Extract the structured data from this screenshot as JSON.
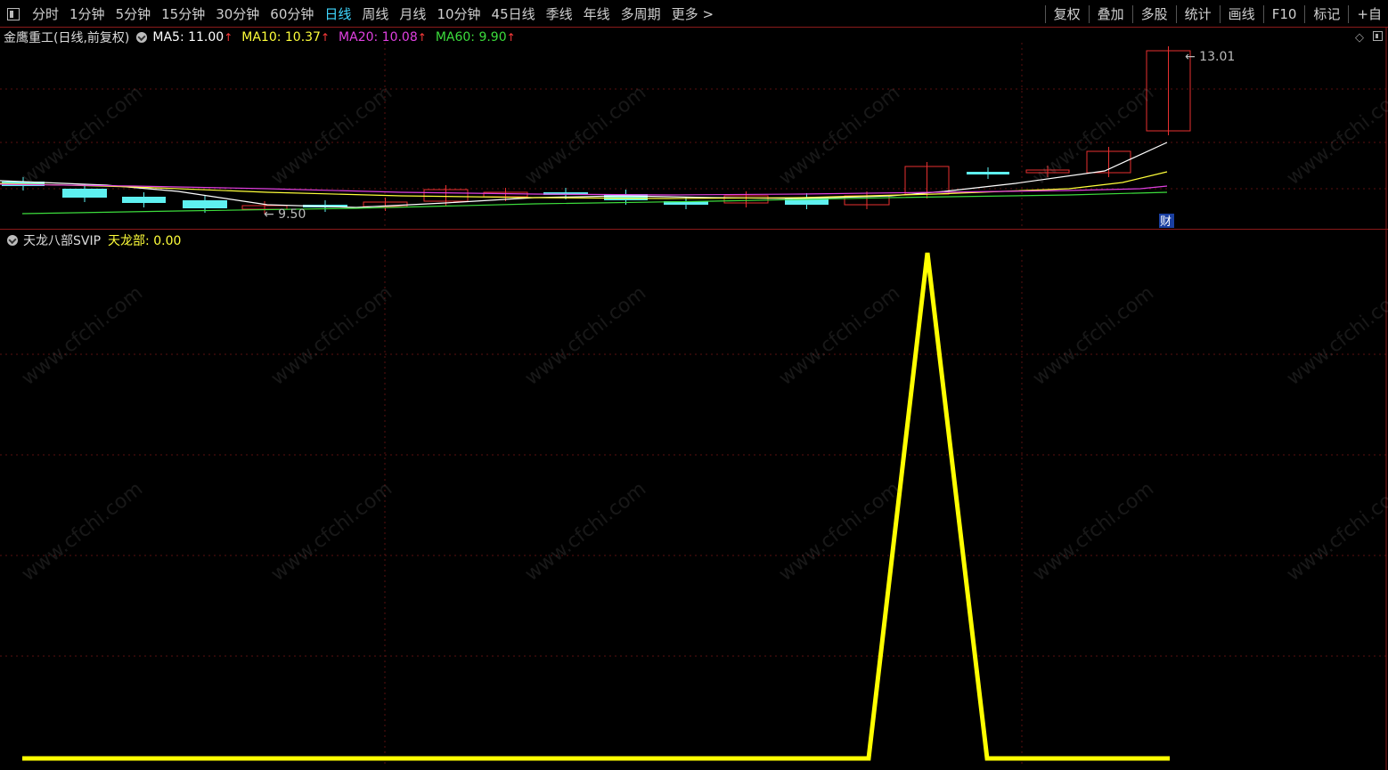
{
  "toolbar": {
    "periods": [
      "分时",
      "1分钟",
      "5分钟",
      "15分钟",
      "30分钟",
      "60分钟",
      "日线",
      "周线",
      "月线",
      "10分钟",
      "45日线",
      "季线",
      "年线",
      "多周期",
      "更多 >"
    ],
    "active_period": "日线",
    "right_tools": [
      "复权",
      "叠加",
      "多股",
      "统计",
      "画线",
      "F10",
      "标记",
      "+自"
    ]
  },
  "main_chart": {
    "stock_title": "金鹰重工(日线,前复权)",
    "ma": [
      {
        "label": "MA5: 11.00",
        "color": "#ffffff"
      },
      {
        "label": "MA10: 10.37",
        "color": "#ffff3a"
      },
      {
        "label": "MA20: 10.08",
        "color": "#e040e0"
      },
      {
        "label": "MA60: 9.90",
        "color": "#3cdc3c"
      }
    ],
    "high_label": "13.01",
    "low_label": "9.50",
    "badge": "财"
  },
  "indicator": {
    "name": "天龙八部SVIP",
    "value_label": "天龙部: 0.00",
    "color": "#ffff00"
  },
  "watermark": "www.cfchi.com",
  "colors": {
    "up": "#e83030",
    "down": "#5ef0f0",
    "grid": "#5a1010",
    "border": "#8a1a1a"
  }
}
